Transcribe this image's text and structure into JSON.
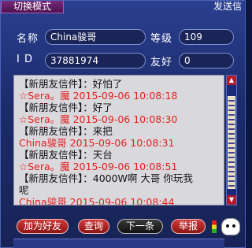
{
  "header": {
    "mode_tab": "切换模式",
    "send_tab": "发送信"
  },
  "profile": {
    "name_label": "名称",
    "name_value": "China骏哥",
    "level_label": "等级",
    "level_value": "109",
    "id_label": "I D",
    "id_value": "37881974",
    "friendship_label": "友好",
    "friendship_value": "0"
  },
  "messages": [
    {
      "text": "【新朋友信件】：好怕了",
      "kind": "notice"
    },
    {
      "text": "☆Sera。魔 2015-09-06 10:08:18",
      "kind": "stamp"
    },
    {
      "text": "【新朋友信件】：好了",
      "kind": "notice"
    },
    {
      "text": "☆Sera。魔 2015-09-06 10:08:30",
      "kind": "stamp"
    },
    {
      "text": "【新朋友信件】：来把",
      "kind": "notice"
    },
    {
      "text": "China骏哥 2015-09-06 10:08:31",
      "kind": "stamp"
    },
    {
      "text": "【新朋友信件】：天台",
      "kind": "notice"
    },
    {
      "text": "☆Sera。魔 2015-09-06 10:08:51",
      "kind": "stamp"
    },
    {
      "text": "【新朋友信件】：4000W啊 大哥 你玩我",
      "kind": "notice"
    },
    {
      "text": "呢",
      "kind": "notice"
    },
    {
      "text": "China骏哥 2015-09-06 10:08:44",
      "kind": "stamp"
    }
  ],
  "buttons": {
    "add_friend": "加为好友",
    "query": "查询",
    "next": "下一条",
    "report": "举报"
  },
  "colors": {
    "timestamp": "#e41e1e",
    "panel": "#1b2a6a"
  }
}
